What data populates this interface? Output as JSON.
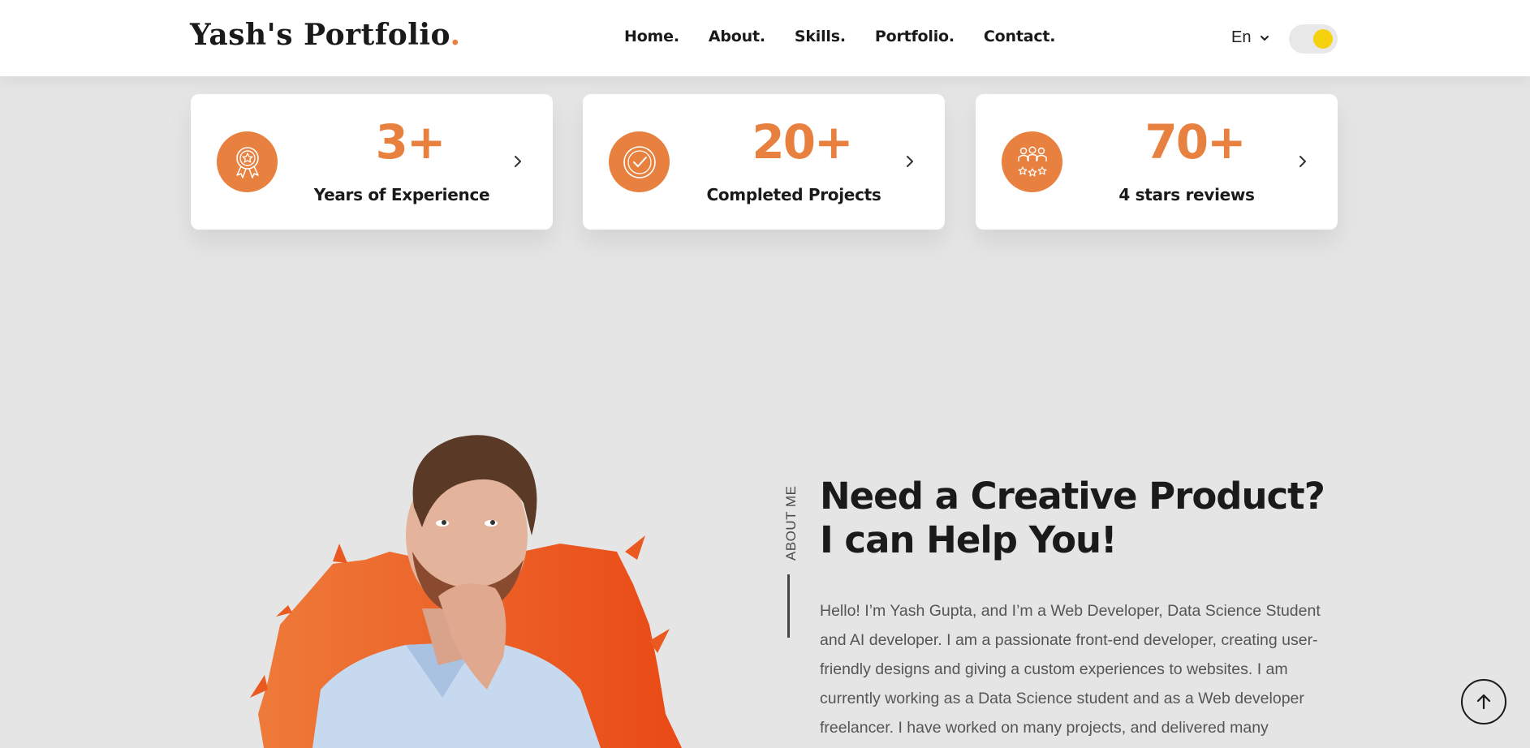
{
  "header": {
    "logo_text": "Yash's Portfolio",
    "logo_dot": ".",
    "nav": [
      "Home.",
      "About.",
      "Skills.",
      "Portfolio.",
      "Contact."
    ],
    "language": "En"
  },
  "colors": {
    "accent": "#e8813f",
    "toggle_knob": "#f5d10f",
    "background": "#e5e5e5"
  },
  "stats": [
    {
      "value": "3+",
      "label": "Years of Experience",
      "icon": "award-badge-icon"
    },
    {
      "value": "20+",
      "label": "Completed Projects",
      "icon": "check-circle-icon"
    },
    {
      "value": "70+",
      "label": "4 stars reviews",
      "icon": "reviews-icon"
    }
  ],
  "about": {
    "section_label": "ABOUT ME",
    "title": "Need a Creative Product? I can Help You!",
    "text": "Hello! I’m Yash Gupta, and I’m a Web Developer, Data Science Student and AI developer. I am a passionate front-end developer, creating user-friendly designs and giving a custom experiences to websites. I am currently working as a Data Science student and as a Web developer freelancer. I have worked on many projects, and delivered many"
  }
}
